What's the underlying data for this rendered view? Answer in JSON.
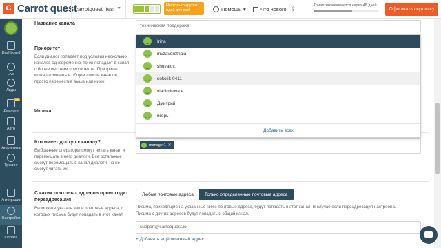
{
  "header": {
    "logo_mark": "C",
    "logo_text": "Carrot quest",
    "project": "carrotquest_test",
    "promo": "Несколько крутых идей для вас!",
    "help": "Помощь",
    "news": "Что нового",
    "trial": "Триал заканчивается через 48 дней",
    "subscribe": "Оформить подписку"
  },
  "sidebar": {
    "items": [
      {
        "label": "Dashboard"
      },
      {
        "label": "Live"
      },
      {
        "label": "Лиды"
      },
      {
        "label": "Диалоги",
        "badge": "99"
      },
      {
        "label": "Авто"
      },
      {
        "label": "Аналитика"
      },
      {
        "label": "Трекинг"
      },
      {
        "label": "Интеграции"
      },
      {
        "label": "Настройки"
      },
      {
        "label": "Оплата"
      }
    ]
  },
  "form": {
    "channel_name_label": "Название канала",
    "channel_name_value": "техническая поддержка",
    "priority_label": "Приоритет",
    "priority_desc": "Если диалог попадает под условия нескольких каналов одновременно, то он попадает в канал с более высоким приоритетом. Приоритет можно изменить в общем списке каналов, просто переместив выше или ниже.",
    "icon_label": "Иконка",
    "access_label": "Кто имеет доступ к каналу?",
    "access_desc": "Выбранные операторы смогут читать канал и перемещать в него диалоги. Все остальные смогут перемещать в канал диалоги, но не смогут читать их.",
    "operators": [
      "Irina",
      "mvzavorotnaia",
      "shuvalov.i",
      "sokolik-0411",
      "vladimirova.v",
      "Дмитрий",
      "игорь"
    ],
    "add_all": "Добавить всех",
    "selected_tag": "manager1",
    "email_label": "С каких почтовых адресов происходит переадресация",
    "email_desc": "Вы можете указать ваши почтовые адреса, с которых письма будут попадать в этот канал",
    "seg_any": "Любые почтовые адреса",
    "seg_specific": "Только определенные почтовые адреса",
    "email_hint1": "Письма, приходящие на указанные ниже почтовые адреса, будут попадать в этот канал. В случае если переадресация настроена.",
    "email_hint2": "Письма с других адресов будут попадать в общий канал.",
    "email_value": "support@carrotquest.io",
    "add_email": "+ Добавить ещё почтовый адрес"
  }
}
